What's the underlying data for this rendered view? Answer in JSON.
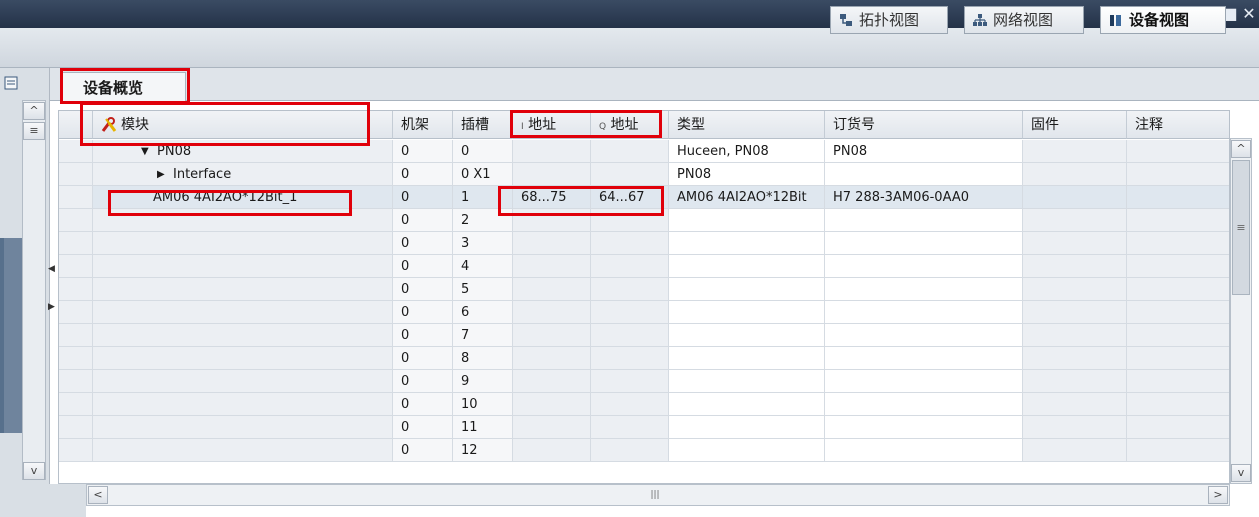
{
  "window": {
    "controls": {
      "minimize": "–",
      "restore": "▯",
      "maximize": "■",
      "close": "✕"
    }
  },
  "views": {
    "topology": "拓扑视图",
    "network": "网络视图",
    "device": "设备视图",
    "active": "device"
  },
  "tab": {
    "label": "设备概览"
  },
  "table": {
    "headers": {
      "module": "模块",
      "rack": "机架",
      "slot": "插槽",
      "i_prefix": "I",
      "i_address": "地址",
      "q_prefix": "Q",
      "q_address": "地址",
      "type": "类型",
      "order_no": "订货号",
      "firmware": "固件",
      "comment": "注释"
    },
    "rows": [
      {
        "module": "PN08",
        "expander": "▼",
        "rack": "0",
        "slot": "0",
        "i_addr": "",
        "q_addr": "",
        "type": "Huceen, PN08",
        "order_no": "PN08"
      },
      {
        "module": "Interface",
        "expander": "▶",
        "rack": "0",
        "slot": "0 X1",
        "i_addr": "",
        "q_addr": "",
        "type": "PN08",
        "order_no": ""
      },
      {
        "module": "AM06 4AI2AO*12Bit_1",
        "expander": "",
        "rack": "0",
        "slot": "1",
        "i_addr": "68...75",
        "q_addr": "64...67",
        "type": "AM06 4AI2AO*12Bit",
        "order_no": "H7 288-3AM06-0AA0"
      },
      {
        "module": "",
        "expander": "",
        "rack": "0",
        "slot": "2",
        "i_addr": "",
        "q_addr": "",
        "type": "",
        "order_no": ""
      },
      {
        "module": "",
        "expander": "",
        "rack": "0",
        "slot": "3",
        "i_addr": "",
        "q_addr": "",
        "type": "",
        "order_no": ""
      },
      {
        "module": "",
        "expander": "",
        "rack": "0",
        "slot": "4",
        "i_addr": "",
        "q_addr": "",
        "type": "",
        "order_no": ""
      },
      {
        "module": "",
        "expander": "",
        "rack": "0",
        "slot": "5",
        "i_addr": "",
        "q_addr": "",
        "type": "",
        "order_no": ""
      },
      {
        "module": "",
        "expander": "",
        "rack": "0",
        "slot": "6",
        "i_addr": "",
        "q_addr": "",
        "type": "",
        "order_no": ""
      },
      {
        "module": "",
        "expander": "",
        "rack": "0",
        "slot": "7",
        "i_addr": "",
        "q_addr": "",
        "type": "",
        "order_no": ""
      },
      {
        "module": "",
        "expander": "",
        "rack": "0",
        "slot": "8",
        "i_addr": "",
        "q_addr": "",
        "type": "",
        "order_no": ""
      },
      {
        "module": "",
        "expander": "",
        "rack": "0",
        "slot": "9",
        "i_addr": "",
        "q_addr": "",
        "type": "",
        "order_no": ""
      },
      {
        "module": "",
        "expander": "",
        "rack": "0",
        "slot": "10",
        "i_addr": "",
        "q_addr": "",
        "type": "",
        "order_no": ""
      },
      {
        "module": "",
        "expander": "",
        "rack": "0",
        "slot": "11",
        "i_addr": "",
        "q_addr": "",
        "type": "",
        "order_no": ""
      },
      {
        "module": "",
        "expander": "",
        "rack": "0",
        "slot": "12",
        "i_addr": "",
        "q_addr": "",
        "type": "",
        "order_no": ""
      }
    ],
    "selected_row": 2
  },
  "scroll": {
    "up": "^",
    "down": "v",
    "left": "<",
    "right": ">",
    "grip": "|||",
    "left_menu": "≡",
    "right_menu": "≡"
  },
  "colors": {
    "annotation": "#e0000a",
    "selection": "#dfe7ef",
    "titlebar": "#243248"
  }
}
